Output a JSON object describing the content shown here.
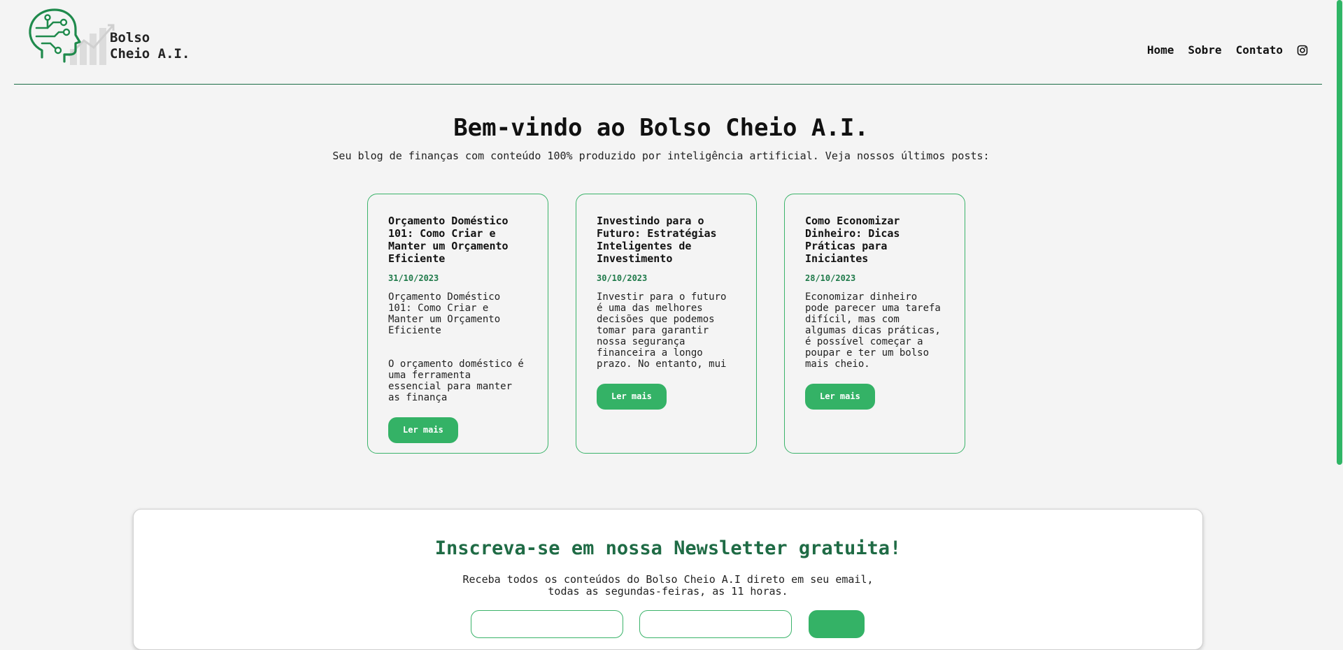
{
  "header": {
    "brand_line1": "Bolso",
    "brand_line2": "Cheio A.I.",
    "nav": {
      "home": "Home",
      "sobre": "Sobre",
      "contato": "Contato"
    }
  },
  "hero": {
    "title": "Bem-vindo ao Bolso Cheio A.I.",
    "subtitle": "Seu blog de finanças com conteúdo 100% produzido por inteligência artificial. Veja nossos últimos posts:"
  },
  "posts": [
    {
      "title": "Orçamento Doméstico 101: Como Criar e Manter um Orçamento Eficiente",
      "date": "31/10/2023",
      "excerpt": "Orçamento Doméstico 101: Como Criar e Manter um Orçamento Eficiente\n\n\nO orçamento doméstico é uma ferramenta essencial para manter as finança",
      "button": "Ler mais"
    },
    {
      "title": "Investindo para o Futuro: Estratégias Inteligentes de Investimento",
      "date": "30/10/2023",
      "excerpt": "Investir para o futuro é uma das melhores decisões que podemos tomar para garantir nossa segurança financeira a longo prazo. No entanto, mui",
      "button": "Ler mais"
    },
    {
      "title": "Como Economizar Dinheiro: Dicas Práticas para Iniciantes",
      "date": "28/10/2023",
      "excerpt": "Economizar dinheiro pode parecer uma tarefa difícil, mas com algumas dicas práticas, é possível começar a poupar e ter um bolso mais cheio.",
      "button": "Ler mais"
    }
  ],
  "newsletter": {
    "title": "Inscreva-se em nossa Newsletter gratuita!",
    "text_line1": "Receba todos os conteúdos do Bolso Cheio A.I direto em seu email,",
    "text_line2": "todas as segundas-feiras, as 11 horas."
  },
  "colors": {
    "accent": "#34b266",
    "dark_green": "#1f6b45",
    "background": "#f4f4f4"
  },
  "icons": {
    "logo": "ai-head-circuit-icon",
    "social": "instagram-icon"
  }
}
